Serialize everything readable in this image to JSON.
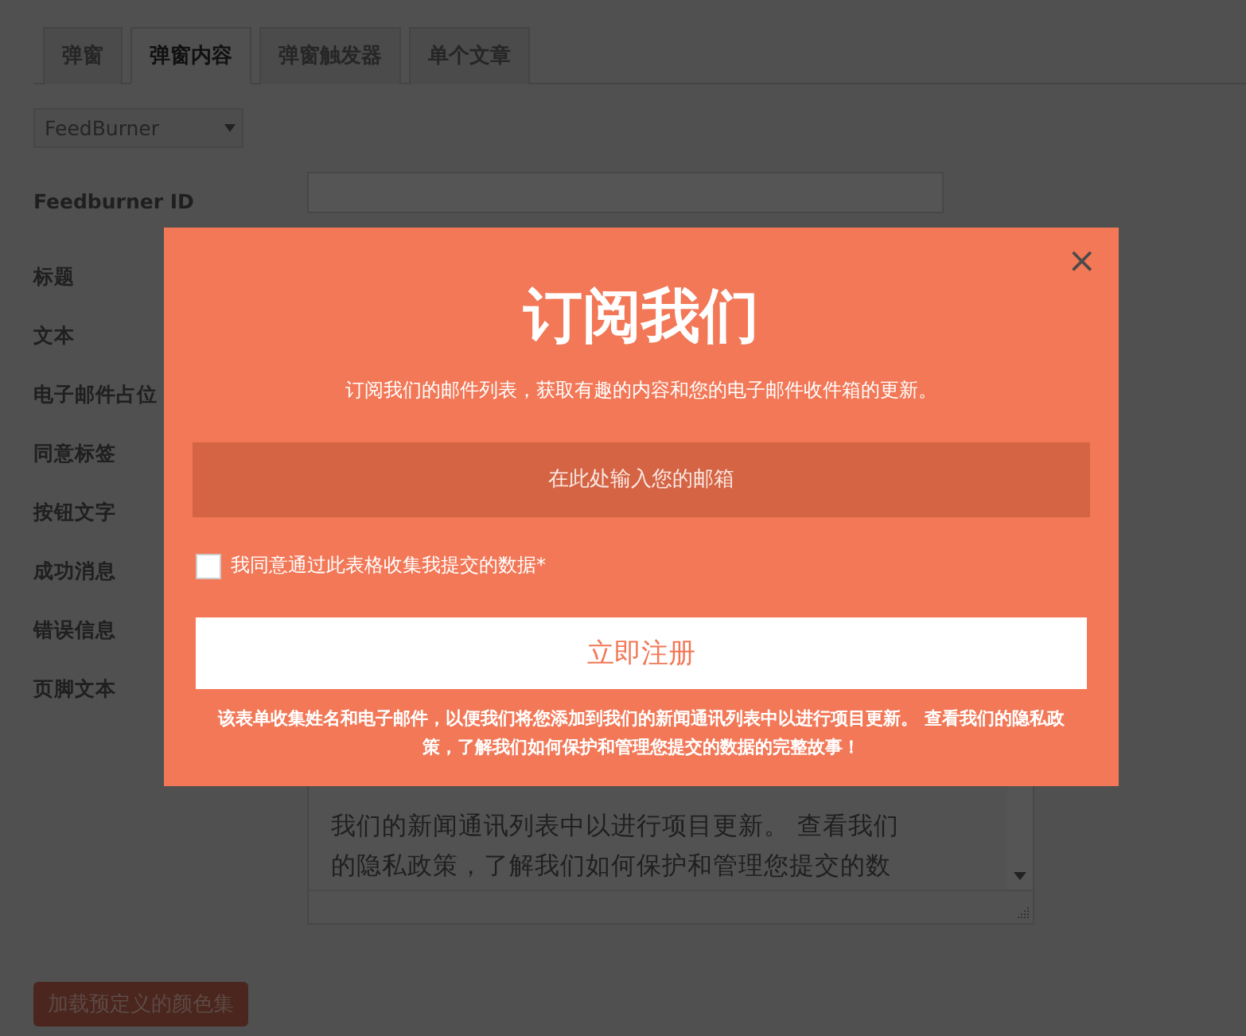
{
  "tabs": [
    {
      "label": "弹窗",
      "selected": false
    },
    {
      "label": "弹窗内容",
      "selected": true
    },
    {
      "label": "弹窗触发器",
      "selected": false
    },
    {
      "label": "单个文章",
      "selected": false
    }
  ],
  "provider_select": {
    "value": "FeedBurner"
  },
  "fields": [
    {
      "label": "Feedburner ID",
      "kind": "input"
    },
    {
      "label": "标题",
      "kind": "none"
    },
    {
      "label": "文本",
      "kind": "none"
    },
    {
      "label": "电子邮件占位",
      "kind": "none"
    },
    {
      "label": "同意标签",
      "kind": "none"
    },
    {
      "label": "按钮文字",
      "kind": "none"
    },
    {
      "label": "成功消息",
      "kind": "none"
    },
    {
      "label": "错误信息",
      "kind": "none"
    },
    {
      "label": "页脚文本",
      "kind": "textarea",
      "lines": [
        "我们的新闻通讯列表中以进行项目更新。 查看我们",
        "的隐私政策，了解我们如何保护和管理您提交的数"
      ]
    }
  ],
  "load_colors_button": "加载预定义的颜色集",
  "popup": {
    "close": "×",
    "title": "订阅我们",
    "text": "订阅我们的邮件列表，获取有趣的内容和您的电子邮件收件箱的更新。",
    "email_placeholder": "在此处输入您的邮箱",
    "consent": {
      "label": "我同意通过此表格收集我提交的数据*",
      "checked": false
    },
    "submit": "立即注册",
    "footer": "该表单收集姓名和电子邮件，以便我们将您添加到我们的新闻通讯列表中以进行项目更新。 查看我们的隐私政策，了解我们如何保护和管理您提交的数据的完整故事！"
  }
}
